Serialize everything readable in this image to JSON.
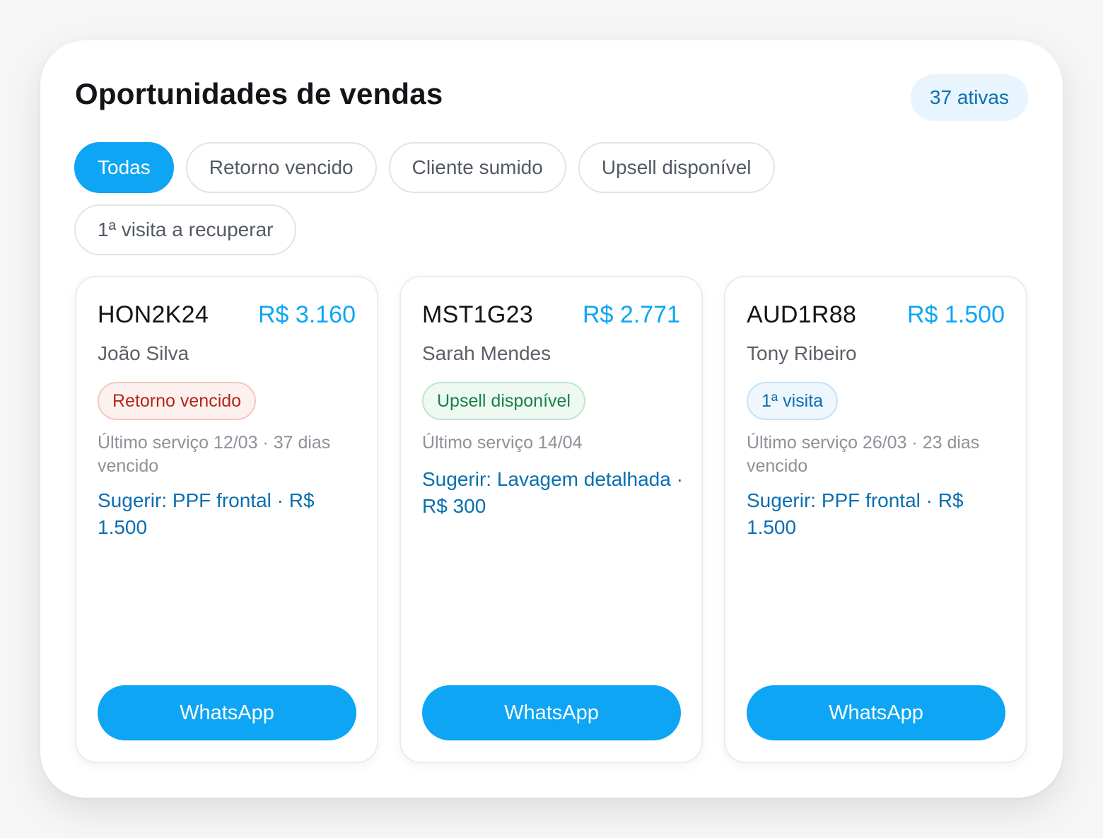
{
  "header": {
    "title": "Oportunidades de vendas",
    "active_count": "37 ativas"
  },
  "filters": [
    {
      "label": "Todas",
      "active": true
    },
    {
      "label": "Retorno vencido",
      "active": false
    },
    {
      "label": "Cliente sumido",
      "active": false
    },
    {
      "label": "Upsell disponível",
      "active": false
    },
    {
      "label": "1ª visita a recuperar",
      "active": false
    }
  ],
  "cards": [
    {
      "plate": "HON2K24",
      "value": "R$ 3.160",
      "client": "João Silva",
      "tag": "Retorno vencido",
      "tag_color": "#b3271b",
      "last_service": "Último serviço 12/03 · 37 dias vencido",
      "suggestion": "Sugerir: PPF frontal · R$ 1.500",
      "button": "WhatsApp"
    },
    {
      "plate": "MST1G23",
      "value": "R$ 2.771",
      "client": "Sarah Mendes",
      "tag": "Upsell disponível",
      "tag_color": "#17804a",
      "last_service": "Último serviço 14/04",
      "suggestion": "Sugerir: Lavagem detalhada · R$ 300",
      "button": "WhatsApp"
    },
    {
      "plate": "AUD1R88",
      "value": "R$ 1.500",
      "client": "Tony Ribeiro",
      "tag": "1ª visita",
      "tag_color": "#0a6fb0",
      "last_service": "Último serviço 26/03 · 23 dias vencido",
      "suggestion": "Sugerir: PPF frontal · R$ 1.500",
      "button": "WhatsApp"
    }
  ],
  "colors": {
    "accent": "#0ea5f4",
    "accent_dark": "#0a6fb0"
  }
}
